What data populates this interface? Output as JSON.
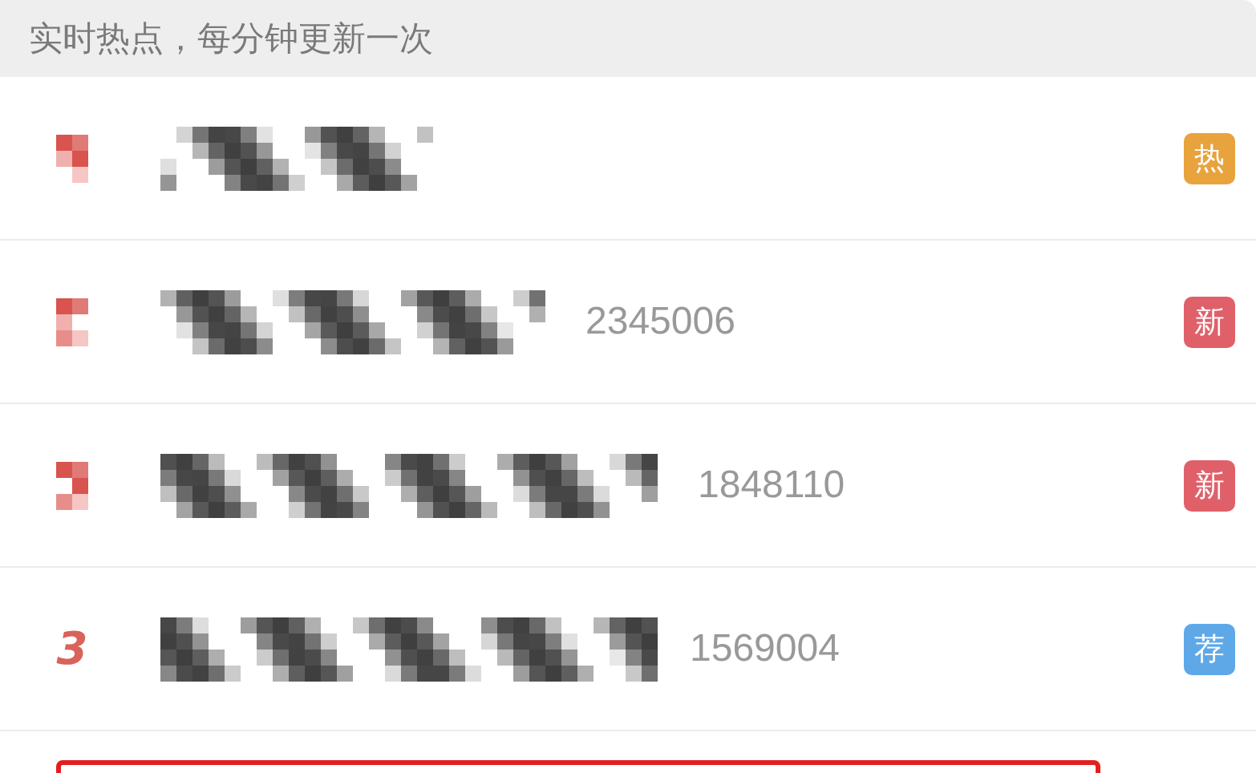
{
  "header": {
    "text": "实时热点，每分钟更新一次"
  },
  "items": [
    {
      "badge": {
        "text": "热",
        "color": "#e8a33d"
      }
    },
    {
      "count": "2345006",
      "badge": {
        "text": "新",
        "color": "#e0606a"
      }
    },
    {
      "count": "1848110",
      "badge": {
        "text": "新",
        "color": "#e0606a"
      }
    },
    {
      "rank": "3",
      "count": "1569004",
      "badge": {
        "text": "荐",
        "color": "#5fa8e8"
      }
    }
  ],
  "highlight": {
    "kind": "frame"
  }
}
